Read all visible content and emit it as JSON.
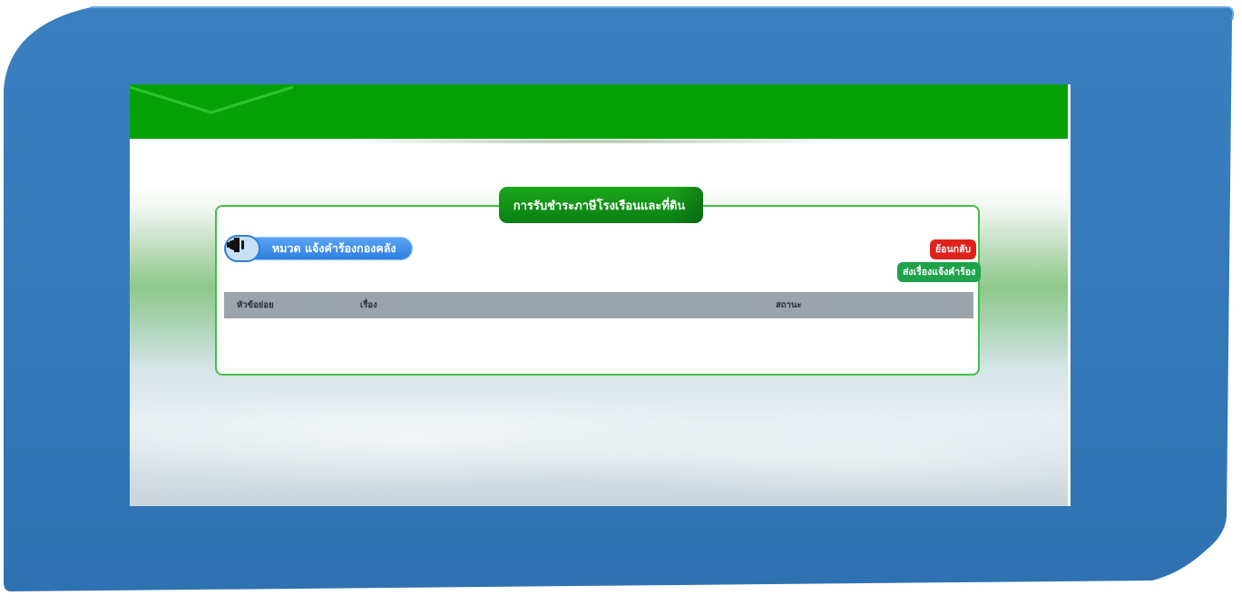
{
  "page": {
    "title": "การรับชำระภาษีโรงเรือนและที่ดิน"
  },
  "category": {
    "label": "หมวด แจ้งคำร้องกองคลัง",
    "icon": "megaphone-icon"
  },
  "actions": {
    "back_label": "ย้อนกลับ",
    "send_label": "ส่งเรื่องแจ้งคำร้อง"
  },
  "table": {
    "columns": [
      "หัวข้อย่อย",
      "เรื่อง",
      "สถานะ"
    ],
    "rows": []
  },
  "colors": {
    "frame_blue": "#2f74b4",
    "header_green": "#06a106",
    "panel_border": "#43c043",
    "back_red": "#e0211c",
    "send_green": "#1ea24a",
    "table_head": "#9ba3ad",
    "category_blue": "#2e7fe0"
  }
}
